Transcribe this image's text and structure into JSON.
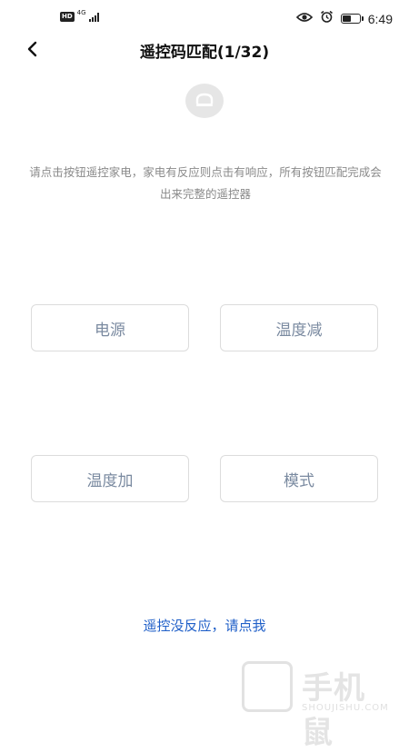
{
  "status_bar": {
    "hd_label": "HD",
    "network_label": "4G",
    "time": "6:49",
    "battery_level": 0.5,
    "icons": [
      "eye-comfort-icon",
      "alarm-icon",
      "battery-icon"
    ]
  },
  "header": {
    "title": "遥控码匹配(1/32)",
    "back_icon": "chevron-left-icon"
  },
  "device_icon": "air-conditioner-icon",
  "instruction": "请点击按钮遥控家电，家电有反应则点击有响应，所有按钮匹配完成会出来完整的遥控器",
  "keys": [
    {
      "label": "电源"
    },
    {
      "label": "温度减"
    },
    {
      "label": "温度加"
    },
    {
      "label": "模式"
    }
  ],
  "no_response_link": "遥控没反应，请点我",
  "watermark": {
    "brand": "手机鼠",
    "sub": "SHOUJISHU.COM"
  },
  "colors": {
    "link": "#1f5fc8",
    "key_text": "#7a8aa0",
    "instruction_text": "#8a8a8a"
  }
}
